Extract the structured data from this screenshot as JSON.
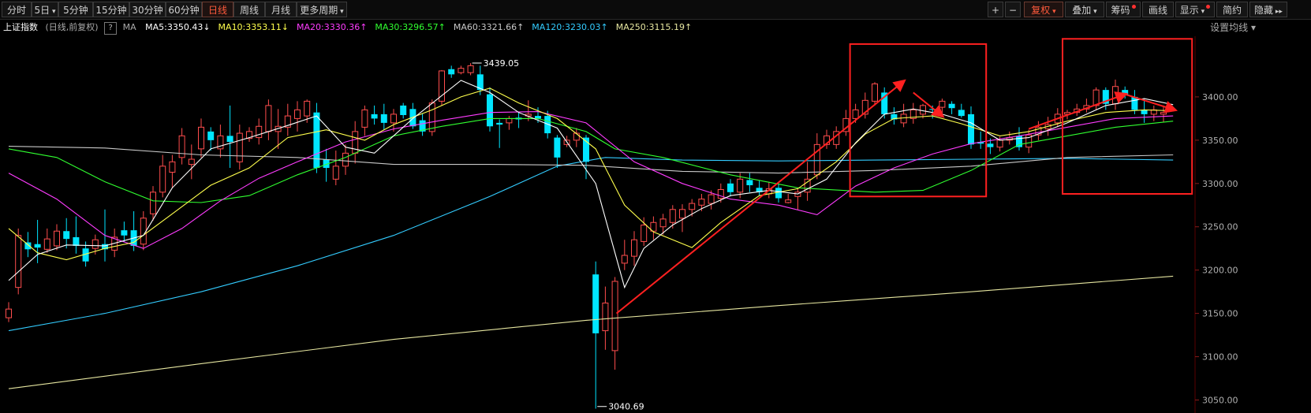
{
  "toolbar": {
    "periods": [
      {
        "label": "分时",
        "active": false
      },
      {
        "label": "5日",
        "active": false,
        "dropdown": true
      },
      {
        "label": "5分钟",
        "active": false
      },
      {
        "label": "15分钟",
        "active": false
      },
      {
        "label": "30分钟",
        "active": false
      },
      {
        "label": "60分钟",
        "active": false
      },
      {
        "label": "日线",
        "active": true
      },
      {
        "label": "周线",
        "active": false
      },
      {
        "label": "月线",
        "active": false
      },
      {
        "label": "更多周期",
        "active": false,
        "dropdown": true
      }
    ],
    "zoom_in": "+",
    "zoom_out": "−",
    "right_buttons": [
      {
        "label": "复权",
        "active": true,
        "dropdown": true
      },
      {
        "label": "叠加",
        "dropdown": true
      },
      {
        "label": "筹码",
        "dot": true
      },
      {
        "label": "画线"
      },
      {
        "label": "显示",
        "dropdown": true,
        "dot": true
      },
      {
        "label": "简约"
      },
      {
        "label": "隐藏",
        "arrows": true
      }
    ]
  },
  "info": {
    "index_name": "上证指数",
    "mode": "(日线,前复权)",
    "help": "?",
    "ma_label": "MA",
    "ma_items": [
      {
        "label": "MA5:3350.43",
        "arrow": "↓",
        "color": "#ffffff"
      },
      {
        "label": "MA10:3353.11",
        "arrow": "↓",
        "color": "#ffff4d"
      },
      {
        "label": "MA20:3330.36",
        "arrow": "↑",
        "color": "#ff3cff"
      },
      {
        "label": "MA30:3296.57",
        "arrow": "↑",
        "color": "#30ff30"
      },
      {
        "label": "MA60:3321.66",
        "arrow": "↑",
        "color": "#c8c8c8"
      },
      {
        "label": "MA120:3230.03",
        "arrow": "↑",
        "color": "#33ccff"
      },
      {
        "label": "MA250:3115.19",
        "arrow": "↑",
        "color": "#e6e6a0"
      }
    ],
    "settings": "设置均线"
  },
  "chart_data": {
    "type": "candlestick",
    "ylim": [
      3035,
      3470
    ],
    "y_ticks": [
      "3050.00",
      "3100.00",
      "3150.00",
      "3200.00",
      "3250.00",
      "3300.00",
      "3350.00",
      "3400.00"
    ],
    "high_label": "3439.05",
    "low_label": "3040.69",
    "colors": {
      "up": "#ff4d4d",
      "down": "#00e5ff",
      "ma5": "#ffffff",
      "ma10": "#ffff4d",
      "ma20": "#ff3cff",
      "ma30": "#30ff30",
      "ma60": "#c8c8c8",
      "ma120": "#33ccff",
      "ma250": "#e6e6a0",
      "annotation": "#ff2020"
    },
    "candles": [
      [
        3145,
        3155,
        3140,
        3163
      ],
      [
        3180,
        3240,
        3172,
        3248
      ],
      [
        3232,
        3224,
        3215,
        3244
      ],
      [
        3230,
        3226,
        3208,
        3258
      ],
      [
        3224,
        3236,
        3220,
        3248
      ],
      [
        3228,
        3245,
        3223,
        3253
      ],
      [
        3245,
        3236,
        3225,
        3260
      ],
      [
        3238,
        3228,
        3219,
        3262
      ],
      [
        3225,
        3210,
        3204,
        3233
      ],
      [
        3225,
        3235,
        3218,
        3241
      ],
      [
        3230,
        3224,
        3210,
        3270
      ],
      [
        3223,
        3238,
        3215,
        3248
      ],
      [
        3246,
        3240,
        3232,
        3256
      ],
      [
        3246,
        3228,
        3222,
        3268
      ],
      [
        3230,
        3260,
        3223,
        3268
      ],
      [
        3265,
        3290,
        3257,
        3297
      ],
      [
        3290,
        3320,
        3284,
        3333
      ],
      [
        3313,
        3325,
        3295,
        3333
      ],
      [
        3330,
        3355,
        3322,
        3364
      ],
      [
        3322,
        3328,
        3305,
        3345
      ],
      [
        3340,
        3365,
        3330,
        3375
      ],
      [
        3360,
        3350,
        3338,
        3365
      ],
      [
        3340,
        3355,
        3330,
        3368
      ],
      [
        3355,
        3348,
        3318,
        3390
      ],
      [
        3325,
        3358,
        3316,
        3368
      ],
      [
        3352,
        3360,
        3348,
        3365
      ],
      [
        3353,
        3366,
        3345,
        3375
      ],
      [
        3360,
        3390,
        3350,
        3397
      ],
      [
        3360,
        3366,
        3340,
        3386
      ],
      [
        3365,
        3378,
        3355,
        3392
      ],
      [
        3375,
        3385,
        3360,
        3395
      ],
      [
        3378,
        3395,
        3370,
        3397
      ],
      [
        3382,
        3318,
        3312,
        3393
      ],
      [
        3328,
        3318,
        3302,
        3340
      ],
      [
        3305,
        3320,
        3298,
        3338
      ],
      [
        3320,
        3335,
        3310,
        3345
      ],
      [
        3335,
        3360,
        3323,
        3372
      ],
      [
        3365,
        3385,
        3355,
        3390
      ],
      [
        3380,
        3375,
        3368,
        3390
      ],
      [
        3380,
        3370,
        3362,
        3392
      ],
      [
        3370,
        3380,
        3360,
        3386
      ],
      [
        3390,
        3379,
        3375,
        3393
      ],
      [
        3386,
        3366,
        3363,
        3393
      ],
      [
        3373,
        3360,
        3355,
        3381
      ],
      [
        3360,
        3393,
        3355,
        3397
      ],
      [
        3395,
        3430,
        3390,
        3431
      ],
      [
        3432,
        3426,
        3422,
        3436
      ],
      [
        3428,
        3433,
        3426,
        3436
      ],
      [
        3428,
        3436,
        3425,
        3439
      ],
      [
        3426,
        3408,
        3402,
        3436
      ],
      [
        3403,
        3366,
        3360,
        3411
      ],
      [
        3370,
        3368,
        3341,
        3374
      ],
      [
        3370,
        3375,
        3362,
        3378
      ],
      [
        3376,
        3374,
        3364,
        3383
      ],
      [
        3378,
        3380,
        3372,
        3396
      ],
      [
        3378,
        3375,
        3370,
        3388
      ],
      [
        3378,
        3358,
        3352,
        3384
      ],
      [
        3353,
        3330,
        3318,
        3356
      ],
      [
        3345,
        3350,
        3342,
        3355
      ],
      [
        3350,
        3358,
        3342,
        3364
      ],
      [
        3353,
        3325,
        3305,
        3356
      ],
      [
        3195,
        3127,
        3040,
        3210
      ],
      [
        3130,
        3162,
        3108,
        3181
      ],
      [
        3107,
        3187,
        3085,
        3192
      ],
      [
        3208,
        3217,
        3200,
        3235
      ],
      [
        3216,
        3235,
        3205,
        3245
      ],
      [
        3233,
        3252,
        3228,
        3261
      ],
      [
        3245,
        3255,
        3235,
        3262
      ],
      [
        3250,
        3259,
        3241,
        3265
      ],
      [
        3255,
        3270,
        3248,
        3275
      ],
      [
        3260,
        3270,
        3244,
        3276
      ],
      [
        3270,
        3277,
        3262,
        3282
      ],
      [
        3275,
        3282,
        3268,
        3288
      ],
      [
        3277,
        3287,
        3270,
        3292
      ],
      [
        3283,
        3293,
        3278,
        3300
      ],
      [
        3300,
        3290,
        3285,
        3305
      ],
      [
        3290,
        3305,
        3283,
        3312
      ],
      [
        3304,
        3298,
        3290,
        3312
      ],
      [
        3295,
        3290,
        3286,
        3304
      ],
      [
        3288,
        3294,
        3283,
        3302
      ],
      [
        3295,
        3283,
        3278,
        3300
      ],
      [
        3278,
        3281,
        3277,
        3288
      ],
      [
        3285,
        3290,
        3270,
        3295
      ],
      [
        3290,
        3305,
        3280,
        3325
      ],
      [
        3310,
        3345,
        3305,
        3358
      ],
      [
        3345,
        3355,
        3340,
        3362
      ],
      [
        3345,
        3360,
        3340,
        3366
      ],
      [
        3360,
        3375,
        3355,
        3385
      ],
      [
        3375,
        3385,
        3370,
        3392
      ],
      [
        3380,
        3396,
        3375,
        3405
      ],
      [
        3395,
        3415,
        3390,
        3417
      ],
      [
        3405,
        3380,
        3375,
        3411
      ],
      [
        3380,
        3374,
        3368,
        3388
      ],
      [
        3370,
        3380,
        3365,
        3392
      ],
      [
        3375,
        3385,
        3369,
        3393
      ],
      [
        3380,
        3390,
        3375,
        3392
      ],
      [
        3386,
        3385,
        3375,
        3390
      ],
      [
        3388,
        3395,
        3380,
        3398
      ],
      [
        3392,
        3387,
        3380,
        3395
      ],
      [
        3385,
        3378,
        3376,
        3392
      ],
      [
        3380,
        3345,
        3340,
        3389
      ],
      [
        3348,
        3346,
        3340,
        3360
      ],
      [
        3346,
        3342,
        3334,
        3352
      ],
      [
        3342,
        3350,
        3337,
        3354
      ],
      [
        3350,
        3353,
        3345,
        3360
      ],
      [
        3355,
        3342,
        3338,
        3365
      ],
      [
        3342,
        3356,
        3335,
        3362
      ],
      [
        3356,
        3365,
        3350,
        3372
      ],
      [
        3363,
        3368,
        3355,
        3377
      ],
      [
        3370,
        3380,
        3365,
        3387
      ],
      [
        3380,
        3382,
        3374,
        3385
      ],
      [
        3382,
        3386,
        3378,
        3392
      ],
      [
        3386,
        3390,
        3382,
        3398
      ],
      [
        3390,
        3408,
        3385,
        3411
      ],
      [
        3408,
        3392,
        3385,
        3411
      ],
      [
        3392,
        3412,
        3385,
        3420
      ],
      [
        3408,
        3402,
        3398,
        3412
      ],
      [
        3400,
        3385,
        3380,
        3408
      ],
      [
        3385,
        3380,
        3370,
        3398
      ],
      [
        3380,
        3385,
        3372,
        3390
      ],
      [
        3380,
        3382,
        3371,
        3390
      ]
    ],
    "ma_series": {
      "ma60": [
        [
          0,
          3343
        ],
        [
          10,
          3341
        ],
        [
          20,
          3333
        ],
        [
          30,
          3330
        ],
        [
          40,
          3322
        ],
        [
          50,
          3322
        ],
        [
          60,
          3321
        ],
        [
          70,
          3314
        ],
        [
          80,
          3312
        ],
        [
          90,
          3315
        ],
        [
          100,
          3320
        ],
        [
          110,
          3330
        ],
        [
          121,
          3333
        ]
      ],
      "ma120": [
        [
          0,
          3130
        ],
        [
          10,
          3150
        ],
        [
          20,
          3175
        ],
        [
          30,
          3205
        ],
        [
          40,
          3240
        ],
        [
          50,
          3285
        ],
        [
          57,
          3320
        ],
        [
          62,
          3330
        ],
        [
          70,
          3327
        ],
        [
          80,
          3326
        ],
        [
          90,
          3327
        ],
        [
          100,
          3328
        ],
        [
          110,
          3329
        ],
        [
          121,
          3327
        ]
      ],
      "ma250": [
        [
          0,
          3063
        ],
        [
          20,
          3092
        ],
        [
          40,
          3120
        ],
        [
          60,
          3142
        ],
        [
          80,
          3159
        ],
        [
          100,
          3175
        ],
        [
          121,
          3193
        ]
      ],
      "ma30": [
        [
          0,
          3340
        ],
        [
          5,
          3330
        ],
        [
          10,
          3302
        ],
        [
          15,
          3280
        ],
        [
          20,
          3278
        ],
        [
          25,
          3286
        ],
        [
          30,
          3310
        ],
        [
          35,
          3330
        ],
        [
          40,
          3355
        ],
        [
          45,
          3366
        ],
        [
          50,
          3375
        ],
        [
          55,
          3375
        ],
        [
          60,
          3360
        ],
        [
          63,
          3340
        ],
        [
          68,
          3330
        ],
        [
          75,
          3310
        ],
        [
          82,
          3295
        ],
        [
          90,
          3290
        ],
        [
          95,
          3292
        ],
        [
          100,
          3315
        ],
        [
          105,
          3345
        ],
        [
          110,
          3355
        ],
        [
          115,
          3365
        ],
        [
          121,
          3372
        ]
      ],
      "ma20": [
        [
          0,
          3312
        ],
        [
          5,
          3282
        ],
        [
          10,
          3240
        ],
        [
          14,
          3225
        ],
        [
          18,
          3248
        ],
        [
          22,
          3280
        ],
        [
          26,
          3306
        ],
        [
          30,
          3325
        ],
        [
          35,
          3348
        ],
        [
          40,
          3363
        ],
        [
          45,
          3373
        ],
        [
          50,
          3382
        ],
        [
          55,
          3383
        ],
        [
          60,
          3370
        ],
        [
          65,
          3325
        ],
        [
          70,
          3300
        ],
        [
          75,
          3282
        ],
        [
          80,
          3275
        ],
        [
          84,
          3264
        ],
        [
          88,
          3297
        ],
        [
          92,
          3318
        ],
        [
          96,
          3334
        ],
        [
          100,
          3346
        ],
        [
          105,
          3355
        ],
        [
          110,
          3365
        ],
        [
          115,
          3375
        ],
        [
          121,
          3378
        ]
      ],
      "ma10": [
        [
          0,
          3248
        ],
        [
          3,
          3220
        ],
        [
          6,
          3212
        ],
        [
          10,
          3225
        ],
        [
          13,
          3232
        ],
        [
          17,
          3265
        ],
        [
          21,
          3298
        ],
        [
          25,
          3318
        ],
        [
          29,
          3353
        ],
        [
          33,
          3362
        ],
        [
          37,
          3350
        ],
        [
          40,
          3368
        ],
        [
          44,
          3385
        ],
        [
          47,
          3400
        ],
        [
          50,
          3410
        ],
        [
          53,
          3393
        ],
        [
          57,
          3375
        ],
        [
          61,
          3340
        ],
        [
          64,
          3275
        ],
        [
          67,
          3244
        ],
        [
          71,
          3226
        ],
        [
          74,
          3255
        ],
        [
          78,
          3286
        ],
        [
          82,
          3294
        ],
        [
          86,
          3325
        ],
        [
          89,
          3357
        ],
        [
          92,
          3375
        ],
        [
          96,
          3378
        ],
        [
          99,
          3369
        ],
        [
          103,
          3355
        ],
        [
          106,
          3360
        ],
        [
          110,
          3372
        ],
        [
          114,
          3382
        ],
        [
          118,
          3385
        ],
        [
          121,
          3384
        ]
      ],
      "ma5": [
        [
          0,
          3188
        ],
        [
          3,
          3218
        ],
        [
          6,
          3229
        ],
        [
          10,
          3228
        ],
        [
          14,
          3240
        ],
        [
          17,
          3295
        ],
        [
          21,
          3340
        ],
        [
          25,
          3353
        ],
        [
          29,
          3367
        ],
        [
          32,
          3378
        ],
        [
          35,
          3342
        ],
        [
          38,
          3335
        ],
        [
          42,
          3375
        ],
        [
          47,
          3419
        ],
        [
          50,
          3405
        ],
        [
          53,
          3382
        ],
        [
          57,
          3364
        ],
        [
          61,
          3300
        ],
        [
          64,
          3180
        ],
        [
          66,
          3225
        ],
        [
          69,
          3252
        ],
        [
          72,
          3271
        ],
        [
          75,
          3286
        ],
        [
          79,
          3292
        ],
        [
          82,
          3288
        ],
        [
          85,
          3305
        ],
        [
          88,
          3347
        ],
        [
          91,
          3380
        ],
        [
          94,
          3386
        ],
        [
          97,
          3380
        ],
        [
          100,
          3370
        ],
        [
          103,
          3350
        ],
        [
          106,
          3353
        ],
        [
          110,
          3370
        ],
        [
          114,
          3390
        ],
        [
          118,
          3398
        ],
        [
          121,
          3391
        ]
      ]
    }
  }
}
